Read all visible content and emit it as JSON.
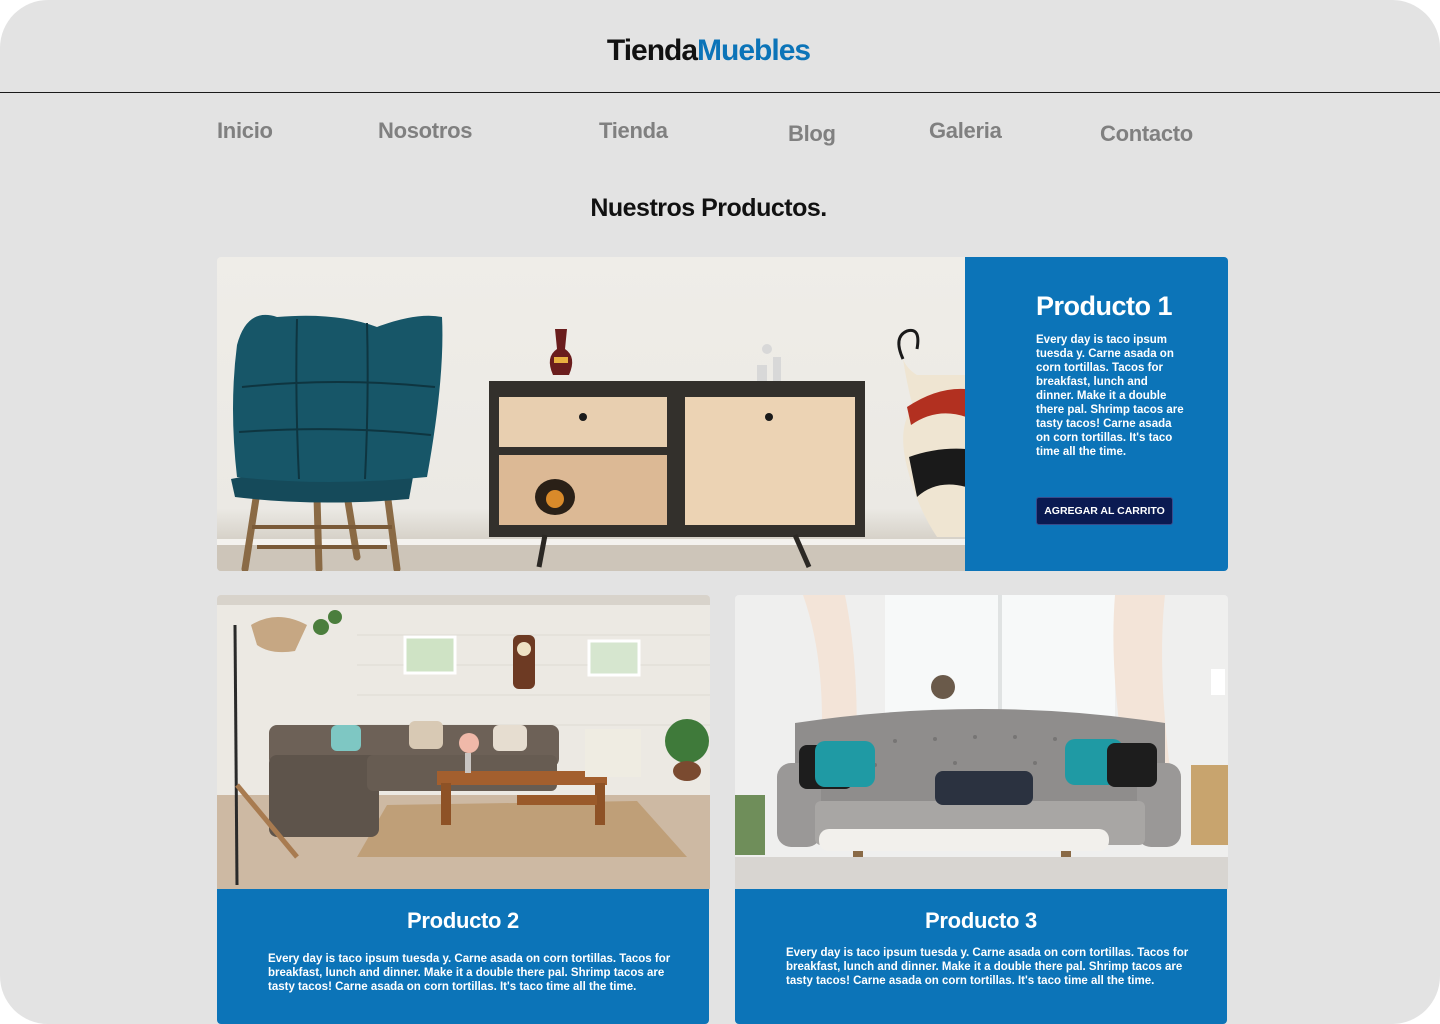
{
  "header": {
    "logo_part1": "Tienda",
    "logo_part2": "Muebles"
  },
  "nav": {
    "items": [
      "Inicio",
      "Nosotros",
      "Tienda",
      "Blog",
      "Galeria",
      "Contacto"
    ]
  },
  "section": {
    "title": "Nuestros Productos."
  },
  "products": [
    {
      "title": "Producto 1",
      "description": "Every day is taco ipsum tuesda y. Carne asada on corn tortillas. Tacos for breakfast, lunch and dinner. Make it a double there pal. Shrimp tacos are tasty tacos! Carne asada on corn tortillas. It's taco time all the time.",
      "button": "AGREGAR AL CARRITO"
    },
    {
      "title": "Producto 2",
      "description": "Every day is taco ipsum tuesda y. Carne asada on corn tortillas. Tacos for breakfast, lunch and dinner. Make it a double there pal. Shrimp tacos are tasty tacos! Carne asada on corn tortillas. It's taco time all the time."
    },
    {
      "title": "Producto 3",
      "description": "Every day is taco ipsum tuesda y. Carne asada on corn tortillas. Tacos for breakfast, lunch and dinner. Make it a double there pal. Shrimp tacos are tasty tacos! Carne asada on corn tortillas. It's taco time all the time."
    }
  ],
  "colors": {
    "background": "#e3e3e3",
    "accent": "#0c74b8",
    "button": "#0a1a52",
    "nav_text": "#808080"
  }
}
